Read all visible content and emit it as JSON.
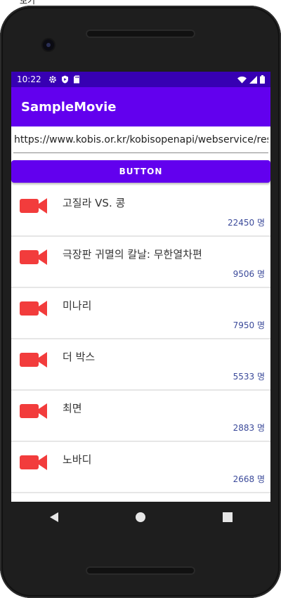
{
  "top_caption": "보기",
  "status_bar": {
    "time": "10:22",
    "left_icons": [
      "gear-icon",
      "shield-icon",
      "sd-card-icon"
    ],
    "right_icons": [
      "wifi-icon",
      "signal-icon",
      "battery-icon"
    ]
  },
  "app_bar": {
    "title": "SampleMovie"
  },
  "url_input": {
    "value": "https://www.kobis.or.kr/kobisopenapi/webservice/rest/boxoffice/searchDailyBoxOfficeList.json"
  },
  "button": {
    "label": "BUTTON"
  },
  "movies": [
    {
      "title": "고질라 VS. 콩",
      "audience": "22450 명"
    },
    {
      "title": "극장판 귀멸의 칼날: 무한열차편",
      "audience": "9506 명"
    },
    {
      "title": "미나리",
      "audience": "7950 명"
    },
    {
      "title": "더 박스",
      "audience": "5533 명"
    },
    {
      "title": "최면",
      "audience": "2883 명"
    },
    {
      "title": "노바디",
      "audience": "2668 명"
    }
  ],
  "colors": {
    "status_bar": "#3700b3",
    "primary": "#6200ee",
    "movie_icon": "#f23c3c",
    "audience_text": "#3b4a9a"
  },
  "nav_icons": [
    "back-icon",
    "home-icon",
    "recents-icon"
  ]
}
